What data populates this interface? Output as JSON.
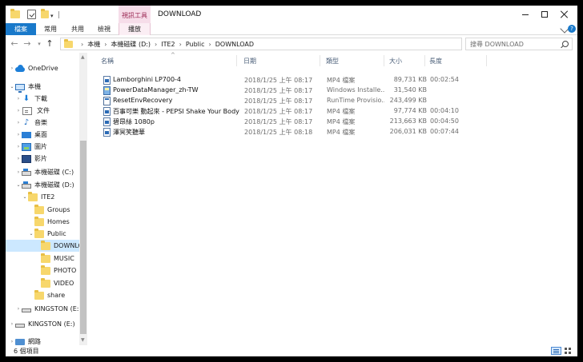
{
  "window": {
    "title": "DOWNLOAD",
    "context_tab_header": "視訊工具"
  },
  "ribbon": {
    "tabs": [
      "檔案",
      "常用",
      "共用",
      "檢視",
      "播放"
    ],
    "active_color": "#1979ca",
    "context_color": "#f6dde9",
    "help_label": "?"
  },
  "address": {
    "crumbs": [
      "本機",
      "本機磁碟 (D:)",
      "ITE2",
      "Public",
      "DOWNLOAD"
    ],
    "search_placeholder": "搜尋 DOWNLOAD"
  },
  "nav": {
    "items": [
      {
        "label": "OneDrive",
        "icon": "onedrive-icon"
      },
      {
        "label": "本機",
        "icon": "this-pc-icon"
      },
      {
        "label": "下載",
        "icon": "downloads-icon"
      },
      {
        "label": "文件",
        "icon": "documents-icon"
      },
      {
        "label": "音樂",
        "icon": "music-icon"
      },
      {
        "label": "桌面",
        "icon": "desktop-icon"
      },
      {
        "label": "圖片",
        "icon": "pictures-icon"
      },
      {
        "label": "影片",
        "icon": "videos-icon"
      },
      {
        "label": "本機磁碟 (C:)",
        "icon": "drive-icon"
      },
      {
        "label": "本機磁碟 (D:)",
        "icon": "drive-icon"
      },
      {
        "label": "ITE2",
        "icon": "folder-icon"
      },
      {
        "label": "Groups",
        "icon": "folder-icon"
      },
      {
        "label": "Homes",
        "icon": "folder-icon"
      },
      {
        "label": "Public",
        "icon": "folder-icon"
      },
      {
        "label": "DOWNLOAD",
        "icon": "folder-icon",
        "selected": true
      },
      {
        "label": "MUSIC",
        "icon": "folder-icon"
      },
      {
        "label": "PHOTO",
        "icon": "folder-icon"
      },
      {
        "label": "VIDEO",
        "icon": "folder-icon"
      },
      {
        "label": "share",
        "icon": "folder-icon"
      },
      {
        "label": "KINGSTON (E:)",
        "icon": "usb-drive-icon"
      },
      {
        "label": "KINGSTON (E:)",
        "icon": "usb-drive-icon"
      },
      {
        "label": "網路",
        "icon": "network-icon"
      }
    ]
  },
  "columns": {
    "name": "名稱",
    "date": "日期",
    "type": "類型",
    "size": "大小",
    "length": "長度"
  },
  "files": [
    {
      "name": "Lamborghini LP700-4",
      "date": "2018/1/25 上午 08:17",
      "type": "MP4 檔案",
      "size": "89,731 KB",
      "length": "00:02:54",
      "icon": "media-file-icon"
    },
    {
      "name": "PowerDataManager_zh-TW",
      "date": "2018/1/25 上午 08:17",
      "type": "Windows Installe...",
      "size": "31,540 KB",
      "length": "",
      "icon": "installer-file-icon"
    },
    {
      "name": "ResetEnvRecovery",
      "date": "2018/1/25 上午 08:17",
      "type": "RunTime Provisio...",
      "size": "243,499 KB",
      "length": "",
      "icon": "runtime-file-icon"
    },
    {
      "name": "百事可樂 動起來 - PEPSI Shake Your Body",
      "date": "2018/1/25 上午 08:17",
      "type": "MP4 檔案",
      "size": "97,774 KB",
      "length": "00:04:10",
      "icon": "media-file-icon"
    },
    {
      "name": "碧昂絲 1080p",
      "date": "2018/1/25 上午 08:17",
      "type": "MP4 檔案",
      "size": "213,663 KB",
      "length": "00:04:50",
      "icon": "media-file-icon"
    },
    {
      "name": "澤冥笑聽華",
      "date": "2018/1/25 上午 08:18",
      "type": "MP4 檔案",
      "size": "206,031 KB",
      "length": "00:07:44",
      "icon": "media-file-icon"
    }
  ],
  "status": {
    "item_count": "6 個項目"
  }
}
